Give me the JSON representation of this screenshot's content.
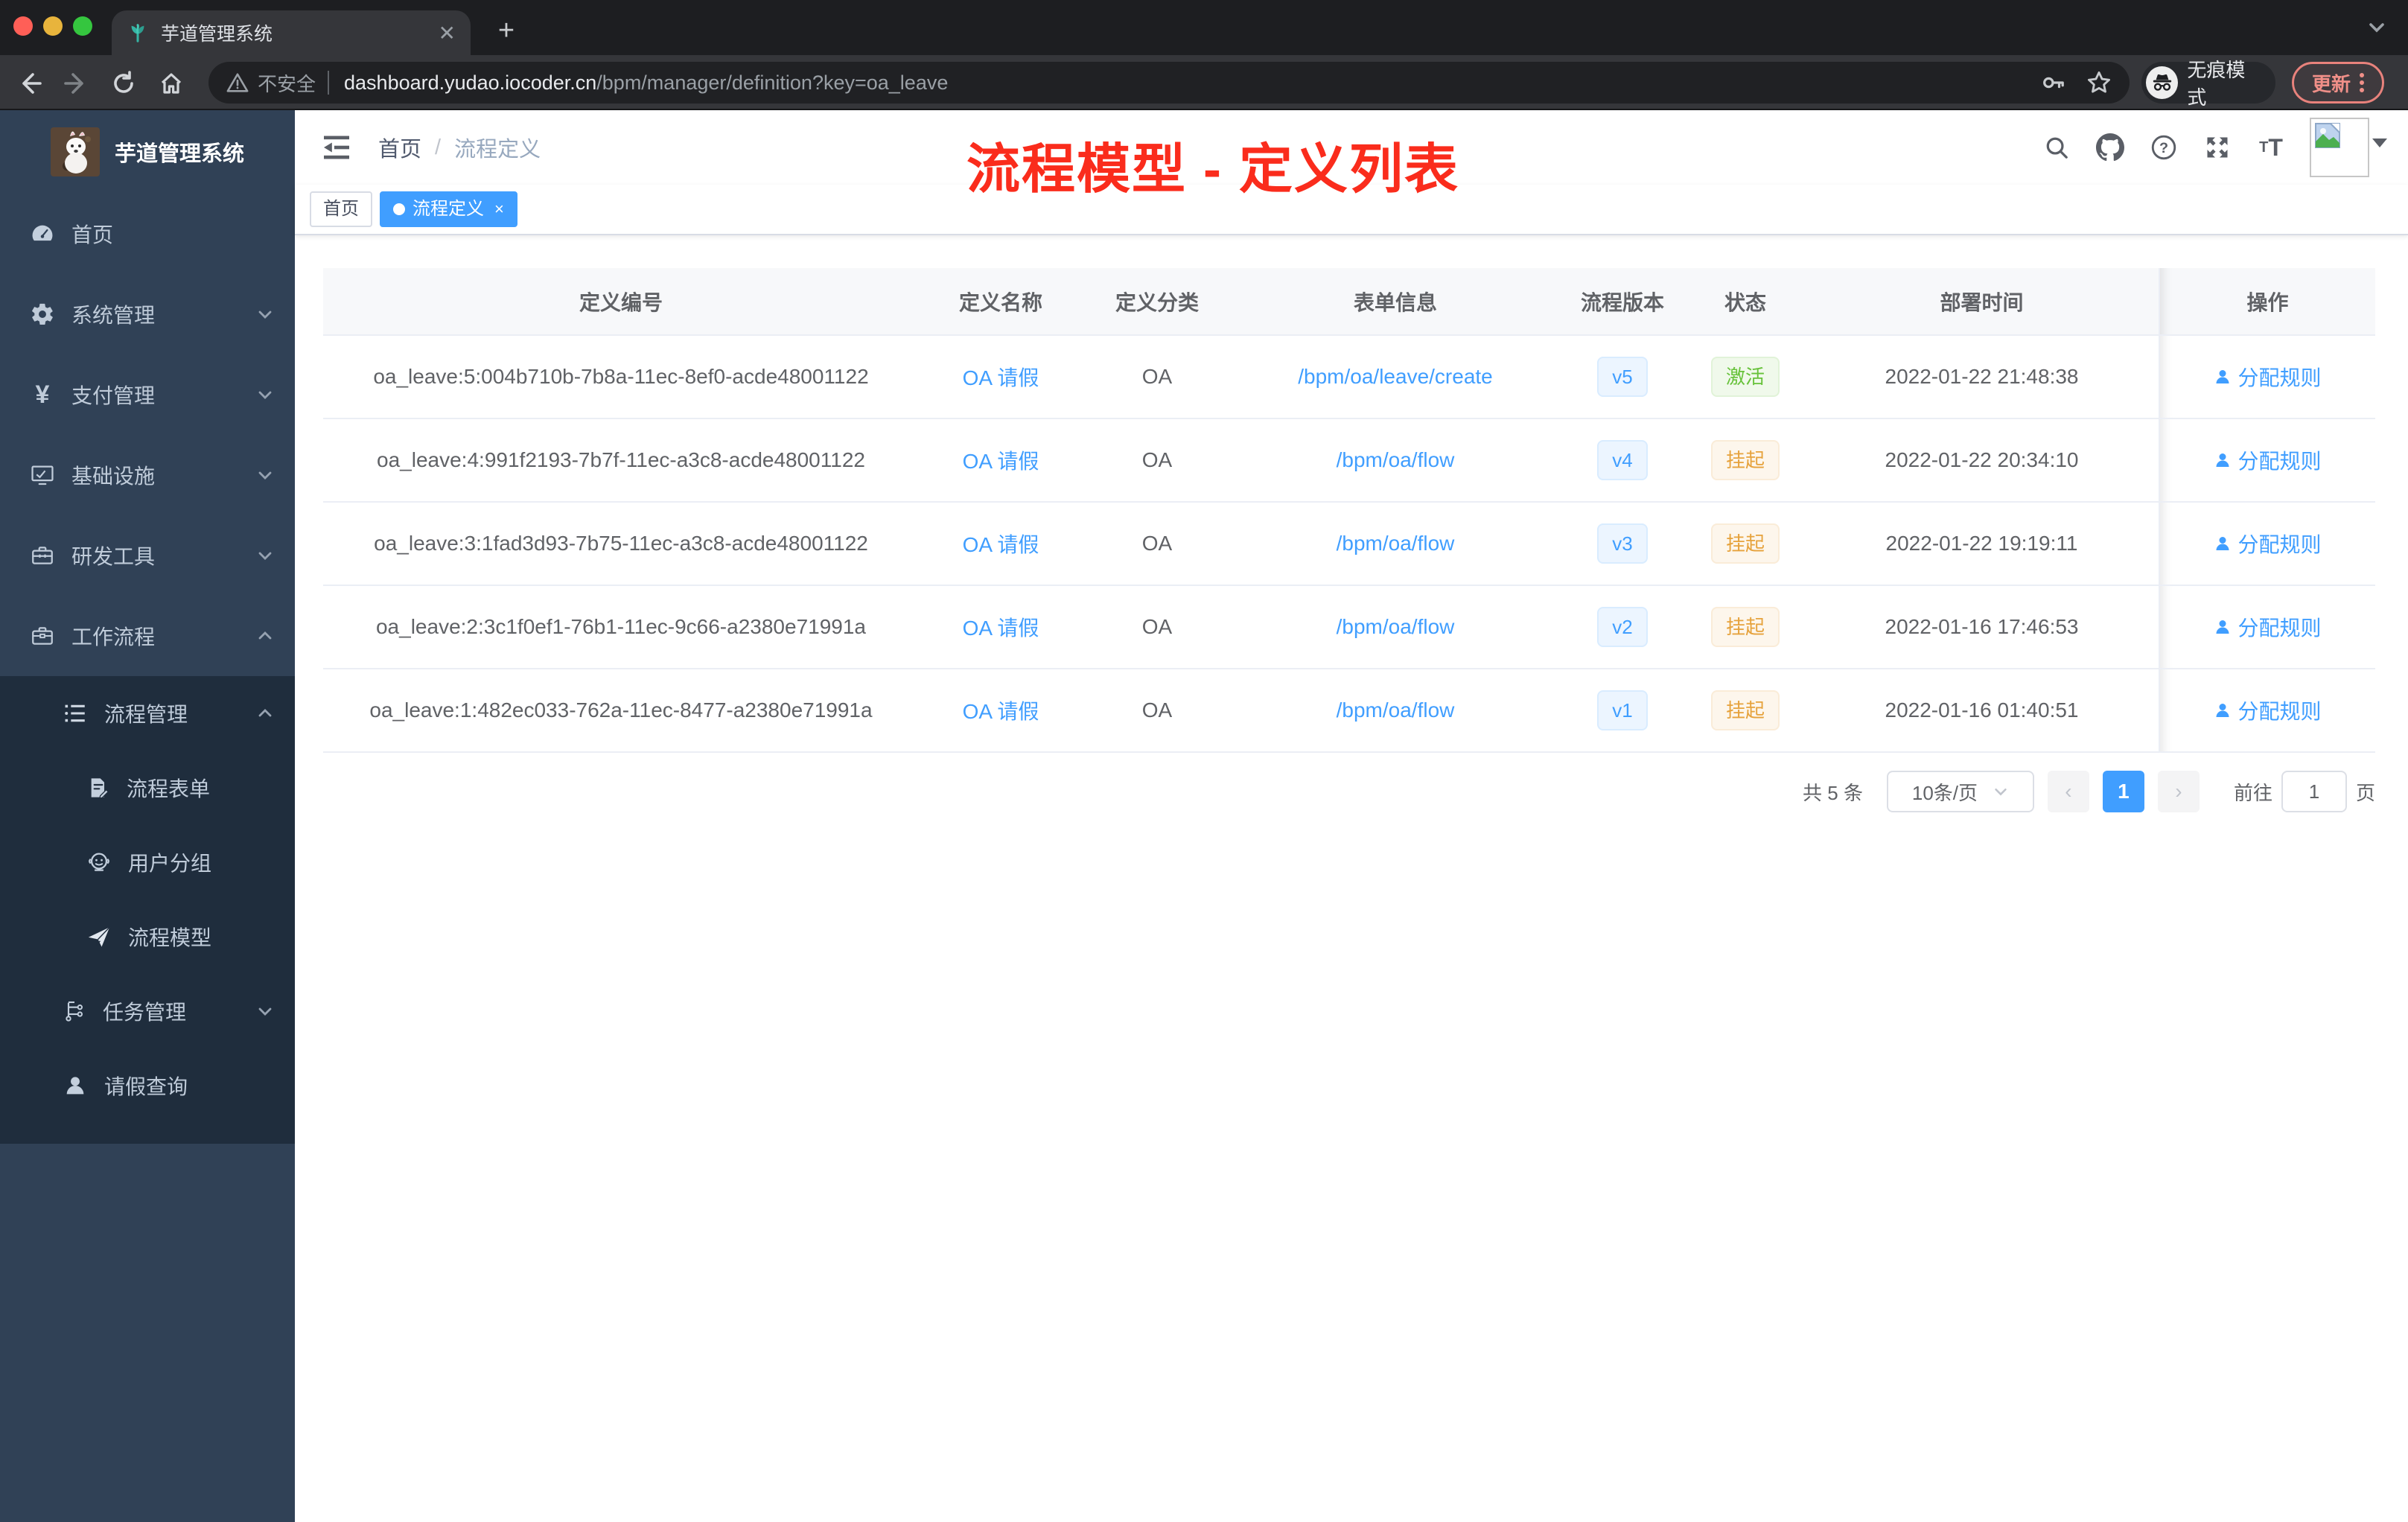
{
  "browser": {
    "tab_title": "芋道管理系统",
    "new_tab": "+",
    "security_label": "不安全",
    "url_host": "dashboard.yudao.iocoder.cn",
    "url_path": "/bpm/manager/definition?key=oa_leave",
    "incognito_label": "无痕模式",
    "update_label": "更新"
  },
  "sidebar": {
    "logo_title": "芋道管理系统",
    "items": [
      {
        "label": "首页",
        "icon": "dashboard-icon"
      },
      {
        "label": "系统管理",
        "icon": "gear-icon",
        "chevron": "down"
      },
      {
        "label": "支付管理",
        "icon": "yen-icon",
        "chevron": "down"
      },
      {
        "label": "基础设施",
        "icon": "monitor-icon",
        "chevron": "down"
      },
      {
        "label": "研发工具",
        "icon": "toolbox-icon",
        "chevron": "down"
      },
      {
        "label": "工作流程",
        "icon": "briefcase-icon",
        "chevron": "up"
      },
      {
        "label": "流程管理",
        "icon": "list-icon",
        "chevron": "up"
      },
      {
        "label": "流程表单",
        "icon": "form-icon"
      },
      {
        "label": "用户分组",
        "icon": "robot-icon"
      },
      {
        "label": "流程模型",
        "icon": "paper-plane-icon"
      },
      {
        "label": "任务管理",
        "icon": "tree-icon",
        "chevron": "down"
      },
      {
        "label": "请假查询",
        "icon": "user-icon"
      }
    ]
  },
  "navbar": {
    "breadcrumb": [
      "首页",
      "流程定义"
    ]
  },
  "annotation": {
    "text": "流程模型 - 定义列表",
    "color": "#fa2c1c"
  },
  "tags": [
    {
      "label": "首页",
      "active": false
    },
    {
      "label": "流程定义",
      "active": true,
      "close": "×"
    }
  ],
  "table": {
    "columns": [
      "定义编号",
      "定义名称",
      "定义分类",
      "表单信息",
      "流程版本",
      "状态",
      "部署时间",
      "操作"
    ],
    "rows": [
      {
        "id": "oa_leave:5:004b710b-7b8a-11ec-8ef0-acde48001122",
        "name": "OA 请假",
        "category": "OA",
        "form": "/bpm/oa/leave/create",
        "version": "v5",
        "status": "激活",
        "status_type": "active",
        "time": "2022-01-22 21:48:38",
        "action": "分配规则"
      },
      {
        "id": "oa_leave:4:991f2193-7b7f-11ec-a3c8-acde48001122",
        "name": "OA 请假",
        "category": "OA",
        "form": "/bpm/oa/flow",
        "version": "v4",
        "status": "挂起",
        "status_type": "suspended",
        "time": "2022-01-22 20:34:10",
        "action": "分配规则"
      },
      {
        "id": "oa_leave:3:1fad3d93-7b75-11ec-a3c8-acde48001122",
        "name": "OA 请假",
        "category": "OA",
        "form": "/bpm/oa/flow",
        "version": "v3",
        "status": "挂起",
        "status_type": "suspended",
        "time": "2022-01-22 19:19:11",
        "action": "分配规则"
      },
      {
        "id": "oa_leave:2:3c1f0ef1-76b1-11ec-9c66-a2380e71991a",
        "name": "OA 请假",
        "category": "OA",
        "form": "/bpm/oa/flow",
        "version": "v2",
        "status": "挂起",
        "status_type": "suspended",
        "time": "2022-01-16 17:46:53",
        "action": "分配规则"
      },
      {
        "id": "oa_leave:1:482ec033-762a-11ec-8477-a2380e71991a",
        "name": "OA 请假",
        "category": "OA",
        "form": "/bpm/oa/flow",
        "version": "v1",
        "status": "挂起",
        "status_type": "suspended",
        "time": "2022-01-16 01:40:51",
        "action": "分配规则"
      }
    ]
  },
  "pagination": {
    "total_label": "共 5 条",
    "page_size": "10条/页",
    "prev": "‹",
    "next": "›",
    "current_page": "1",
    "goto_label": "前往",
    "goto_value": "1",
    "page_unit": "页"
  },
  "colors": {
    "accent_blue": "#409eff",
    "sidebar_bg": "#304156",
    "submenu_bg": "#1f2d3d",
    "status_active": "#67c23a",
    "status_suspended": "#e6a23c",
    "annotation_red": "#fa2c1c",
    "tag_active_bg": "#409eff"
  }
}
